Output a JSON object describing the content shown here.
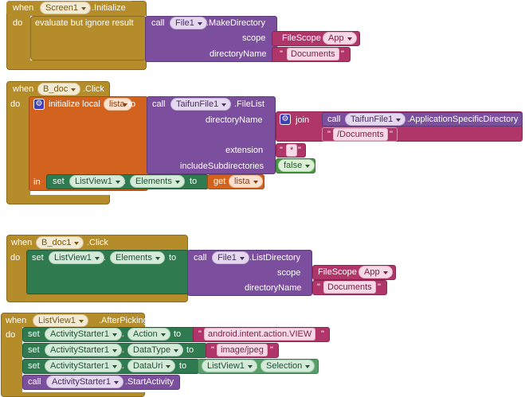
{
  "kw": {
    "when": "when",
    "do": "do",
    "call": "call",
    "set": "set",
    "get": "get",
    "to": "to",
    "in": "in",
    "dot": ".",
    "quote": "\"",
    "join": "join",
    "initialize_local": "initialize local",
    "evaluate_ignore": "evaluate but ignore result"
  },
  "block1": {
    "component": "Screen1",
    "event": ".Initialize",
    "call_component": "File1",
    "call_method": ".MakeDirectory",
    "scope_label": "scope",
    "scope_enum": "FileScope",
    "scope_value": "App",
    "dir_label": "directoryName",
    "dir_value": "Documents"
  },
  "block2": {
    "component": "B_doc",
    "event": ".Click",
    "local_name": "lista",
    "call_component": "TaifunFile1",
    "call_method": ".FileList",
    "dir_label": "directoryName",
    "join_call_component": "TaifunFile1",
    "join_call_method": ".ApplicationSpecificDirectory",
    "join_string": "/Documents",
    "ext_label": "extension",
    "ext_value": "*",
    "sub_label": "includeSubdirectories",
    "sub_value": "false",
    "set_component": "ListView1",
    "set_property": "Elements",
    "get_var": "lista"
  },
  "block3": {
    "component": "B_doc1",
    "event": ".Click",
    "set_component": "ListView1",
    "set_property": "Elements",
    "call_component": "File1",
    "call_method": ".ListDirectory",
    "scope_label": "scope",
    "scope_enum": "FileScope",
    "scope_value": "App",
    "dir_label": "directoryName",
    "dir_value": "Documents"
  },
  "block4": {
    "component": "ListView1",
    "event": ".AfterPicking",
    "rows": [
      {
        "component": "ActivityStarter1",
        "property": "Action",
        "value": "android.intent.action.VIEW"
      },
      {
        "component": "ActivityStarter1",
        "property": "DataType",
        "value": "image/jpeg"
      },
      {
        "component": "ActivityStarter1",
        "property": "DataUri",
        "value_component": "ListView1",
        "value_property": "Selection"
      }
    ],
    "call_component": "ActivityStarter1",
    "call_method": ".StartActivity"
  }
}
